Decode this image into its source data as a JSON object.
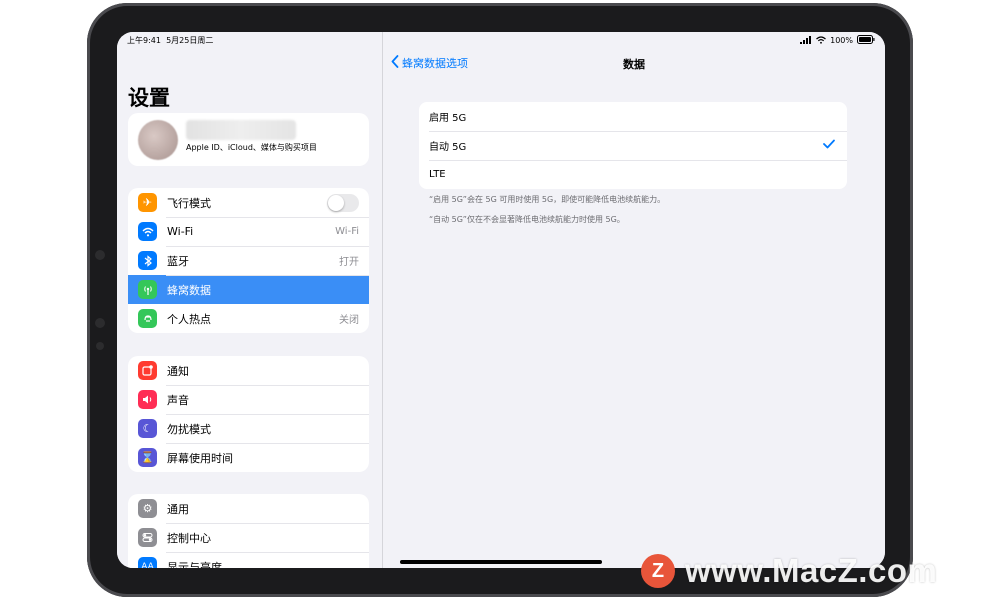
{
  "status_bar": {
    "time": "上午9:41",
    "date": "5月25日周二",
    "battery": "100%"
  },
  "sidebar": {
    "title": "设置",
    "profile": {
      "subtitle": "Apple ID、iCloud、媒体与购买项目"
    },
    "groups": [
      [
        {
          "label": "飞行模式",
          "icon": "airplane-icon",
          "color": "#ff9500",
          "toggle": false
        },
        {
          "label": "Wi-Fi",
          "icon": "wifi-icon",
          "color": "#007aff",
          "value": "Wi-Fi"
        },
        {
          "label": "蓝牙",
          "icon": "bluetooth-icon",
          "color": "#007aff",
          "value": "打开"
        },
        {
          "label": "蜂窝数据",
          "icon": "cellular-icon",
          "color": "#34c759",
          "selected": true
        },
        {
          "label": "个人热点",
          "icon": "hotspot-icon",
          "color": "#34c759",
          "value": "关闭"
        }
      ],
      [
        {
          "label": "通知",
          "icon": "notifications-icon",
          "color": "#ff3b30"
        },
        {
          "label": "声音",
          "icon": "sound-icon",
          "color": "#ff2d55"
        },
        {
          "label": "勿扰模式",
          "icon": "moon-icon",
          "color": "#5856d6"
        },
        {
          "label": "屏幕使用时间",
          "icon": "hourglass-icon",
          "color": "#5856d6"
        }
      ],
      [
        {
          "label": "通用",
          "icon": "gear-icon",
          "color": "#8e8e93"
        },
        {
          "label": "控制中心",
          "icon": "control-center-icon",
          "color": "#8e8e93"
        },
        {
          "label": "显示与亮度",
          "icon": "display-icon",
          "color": "#007aff"
        }
      ]
    ]
  },
  "detail": {
    "back_label": "蜂窝数据选项",
    "title": "数据",
    "options": [
      {
        "label": "启用 5G",
        "checked": false
      },
      {
        "label": "自动 5G",
        "checked": true
      },
      {
        "label": "LTE",
        "checked": false
      }
    ],
    "footnote_1": "“启用 5G”会在 5G 可用时使用 5G，即使可能降低电池续航能力。",
    "footnote_2": "“自动 5G”仅在不会显著降低电池续航能力时使用 5G。"
  },
  "watermark": {
    "logo_letter": "Z",
    "text": "www.MacZ.com"
  }
}
